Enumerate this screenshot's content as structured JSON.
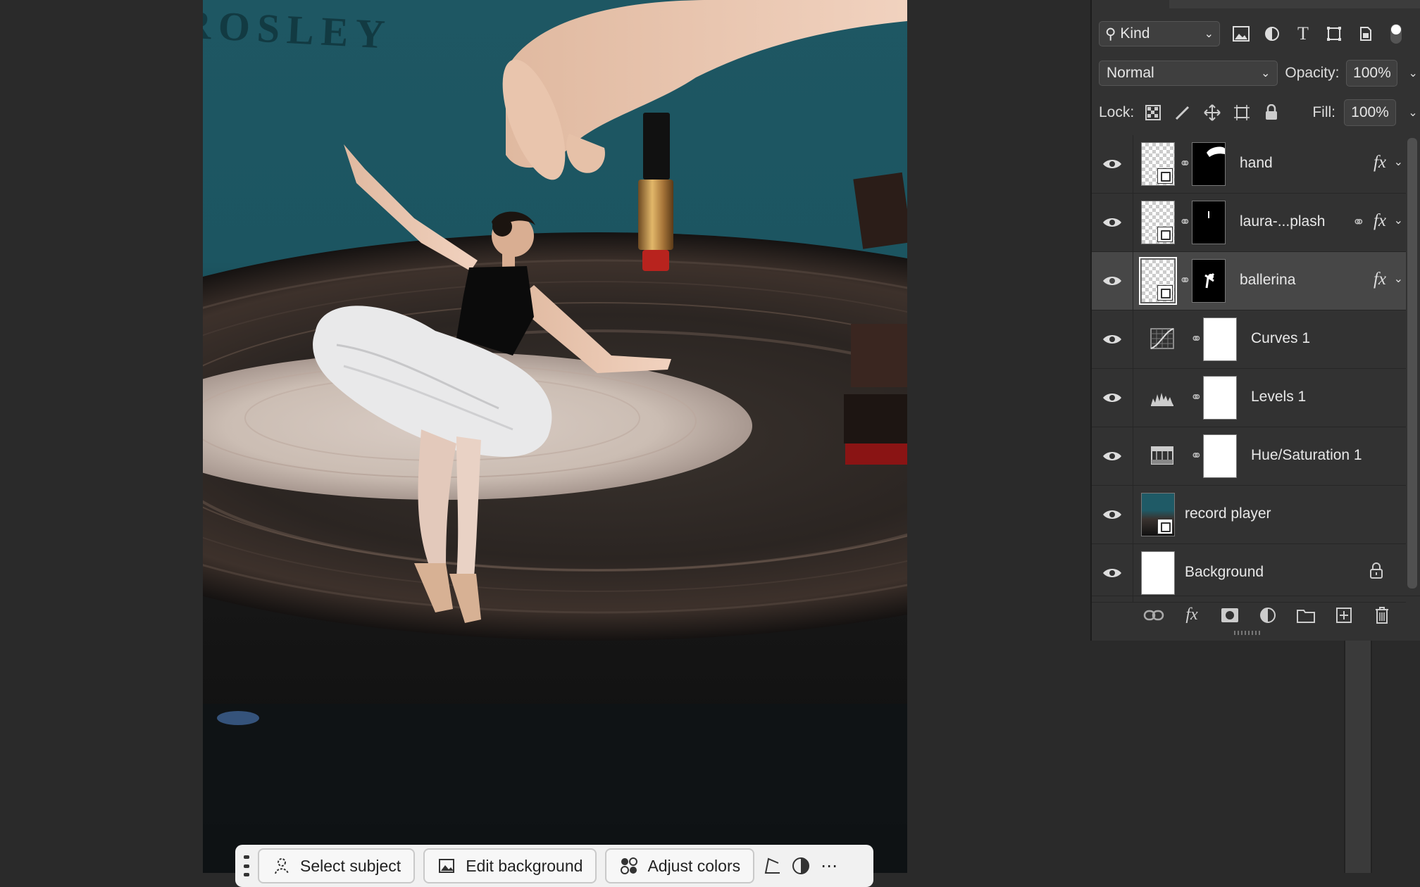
{
  "canvas": {
    "brand_text": "ROSLEY"
  },
  "taskbar": {
    "buttons": [
      {
        "label": "Select subject",
        "icon": "person-select-icon"
      },
      {
        "label": "Edit background",
        "icon": "image-edit-icon"
      },
      {
        "label": "Adjust colors",
        "icon": "color-adjust-icon"
      }
    ]
  },
  "layers_panel": {
    "filter": {
      "label": "Kind",
      "icon": "search-icon"
    },
    "filter_icons": [
      "pixel-layer-filter-icon",
      "adjustment-layer-filter-icon",
      "type-layer-filter-icon",
      "shape-layer-filter-icon",
      "smart-object-filter-icon"
    ],
    "blend_mode": "Normal",
    "opacity_label": "Opacity:",
    "opacity_value": "100%",
    "lock_label": "Lock:",
    "fill_label": "Fill:",
    "fill_value": "100%",
    "layers": [
      {
        "name": "hand",
        "fx": "fx",
        "selected": false
      },
      {
        "name": "laura-...plash",
        "fx": "fx",
        "selected": false
      },
      {
        "name": "ballerina",
        "fx": "fx",
        "selected": true
      },
      {
        "name": "Curves 1"
      },
      {
        "name": "Levels 1"
      },
      {
        "name": "Hue/Saturation 1"
      },
      {
        "name": "record player"
      },
      {
        "name": "Background",
        "locked": true
      }
    ],
    "footer_icons": [
      "link-layers-icon",
      "fx-icon",
      "add-mask-icon",
      "adjustment-icon",
      "new-group-icon",
      "new-layer-icon",
      "delete-icon"
    ]
  },
  "colors": {
    "panel_bg": "#323232",
    "selected_row": "#474747",
    "canvas_teal": "#1e5763"
  }
}
